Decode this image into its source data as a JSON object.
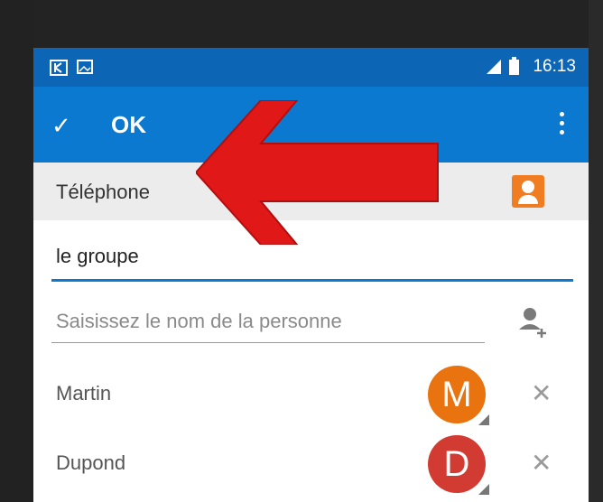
{
  "status_bar": {
    "time": "16:13",
    "icons": [
      "app-notification-icon",
      "image-notification-icon",
      "signal-icon",
      "battery-icon"
    ]
  },
  "action_bar": {
    "confirm_label": "OK",
    "confirm_icon": "check-icon",
    "overflow_icon": "more-vert-icon"
  },
  "section": {
    "title": "Téléphone",
    "icon": "contact-card-icon"
  },
  "group_name": {
    "value": "le groupe"
  },
  "add_person": {
    "placeholder": "Saisissez le nom de la personne",
    "icon": "add-person-icon"
  },
  "members": [
    {
      "name": "Martin",
      "initial": "M",
      "color": "#e8730f"
    },
    {
      "name": "Dupond",
      "initial": "D",
      "color": "#d23b32"
    }
  ],
  "colors": {
    "status_bar": "#0c66b5",
    "action_bar": "#0b79d0",
    "accent_arrow": "#e01818"
  }
}
